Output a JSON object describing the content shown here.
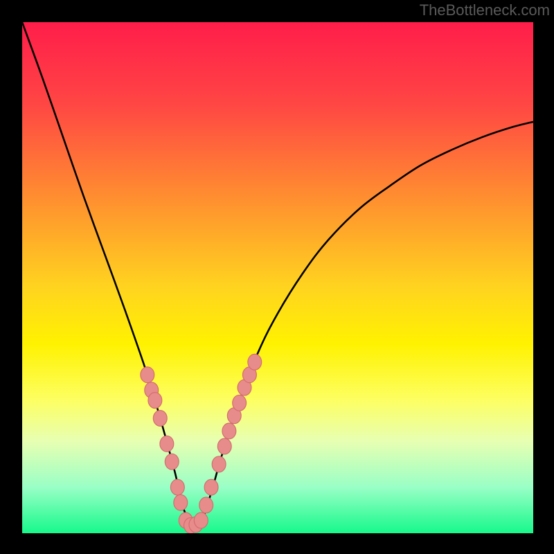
{
  "watermark": "TheBottleneck.com",
  "chart_data": {
    "type": "line",
    "title": "",
    "xlabel": "",
    "ylabel": "",
    "xlim": [
      0,
      100
    ],
    "ylim": [
      0,
      100
    ],
    "grid": false,
    "legend": null,
    "background_gradient_stops": [
      {
        "offset": "0%",
        "color": "#ff1d4a"
      },
      {
        "offset": "16%",
        "color": "#ff4644"
      },
      {
        "offset": "34%",
        "color": "#ff8d30"
      },
      {
        "offset": "52%",
        "color": "#ffd41f"
      },
      {
        "offset": "63%",
        "color": "#fff200"
      },
      {
        "offset": "74%",
        "color": "#fdff62"
      },
      {
        "offset": "82%",
        "color": "#e7ffb2"
      },
      {
        "offset": "91%",
        "color": "#99ffc6"
      },
      {
        "offset": "100%",
        "color": "#16f98b"
      }
    ],
    "series": [
      {
        "name": "bottleneck-curve",
        "stroke": "#000000",
        "stroke_width": 2.2,
        "x": [
          0.0,
          4.0,
          8.0,
          12.0,
          16.0,
          20.0,
          24.0,
          26.0,
          28.0,
          30.0,
          31.5,
          33.5,
          35.0,
          37.0,
          39.0,
          42.0,
          46.0,
          50.0,
          55.0,
          60.0,
          66.0,
          72.0,
          78.0,
          84.0,
          90.0,
          96.0,
          100.0
        ],
        "y": [
          100.0,
          89.0,
          77.5,
          66.0,
          55.0,
          44.0,
          32.5,
          26.0,
          19.0,
          11.5,
          5.0,
          1.5,
          2.0,
          8.0,
          15.0,
          24.5,
          35.0,
          43.0,
          51.0,
          57.5,
          63.5,
          68.0,
          72.0,
          75.0,
          77.5,
          79.5,
          80.5
        ]
      }
    ],
    "markers": {
      "name": "highlight-dots",
      "fill": "#e88b8b",
      "stroke": "#d06c6c",
      "left_cluster": {
        "x": [
          24.5,
          25.3,
          26.0,
          27.0,
          28.3,
          29.3,
          30.4,
          31.0
        ],
        "y": [
          31.0,
          28.0,
          26.0,
          22.5,
          17.5,
          14.0,
          9.0,
          6.0
        ]
      },
      "valley": {
        "x": [
          32.0,
          33.0,
          34.0,
          35.0
        ],
        "y": [
          2.5,
          1.5,
          1.7,
          2.5
        ]
      },
      "right_cluster": {
        "x": [
          36.0,
          37.0,
          38.5,
          39.6,
          40.5,
          41.5,
          42.5,
          43.5,
          44.5,
          45.5
        ],
        "y": [
          5.5,
          9.0,
          13.5,
          17.0,
          20.0,
          23.0,
          25.5,
          28.5,
          31.0,
          33.5
        ]
      }
    }
  }
}
